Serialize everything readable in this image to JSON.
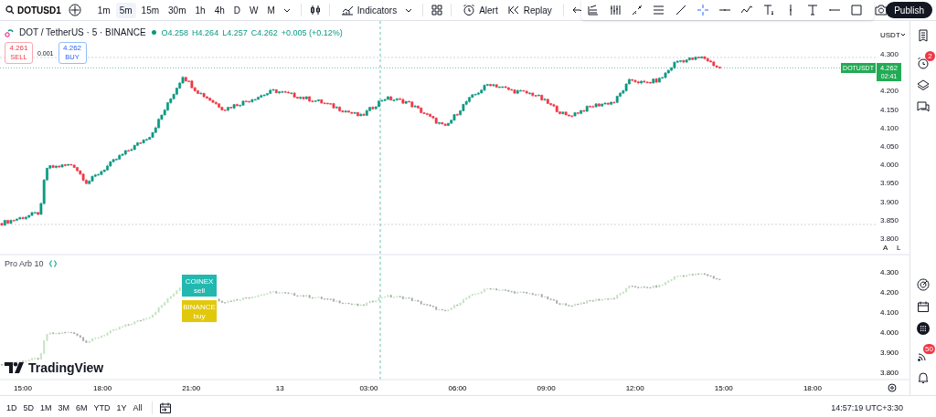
{
  "symbol_search": {
    "value": "DOTUSD1"
  },
  "intervals": [
    {
      "label": "1m",
      "selected": false
    },
    {
      "label": "5m",
      "selected": true
    },
    {
      "label": "15m",
      "selected": false
    },
    {
      "label": "30m",
      "selected": false
    },
    {
      "label": "1h",
      "selected": false
    },
    {
      "label": "4h",
      "selected": false
    },
    {
      "label": "D",
      "selected": false
    },
    {
      "label": "W",
      "selected": false
    },
    {
      "label": "M",
      "selected": false
    }
  ],
  "toolbar": {
    "indicators": "Indicators",
    "alert": "Alert",
    "replay": "Replay",
    "publish": "Publish"
  },
  "legend": {
    "title": "DOT / TetherUS · 5 · BINANCE",
    "ohlc": [
      {
        "label": "O",
        "value": "4.258"
      },
      {
        "label": "H",
        "value": "4.264"
      },
      {
        "label": "L",
        "value": "4.257"
      },
      {
        "label": "C",
        "value": "4.262"
      }
    ],
    "change": "+0.005 (+0.12%)"
  },
  "trade": {
    "sell_price": "4.261",
    "sell_label": "SELL",
    "spread": "0.001",
    "buy_price": "4.262",
    "buy_label": "BUY"
  },
  "price_axis": {
    "currency": "USDT",
    "labels": [
      "4.300",
      "4.200",
      "4.150",
      "4.100",
      "4.050",
      "4.000",
      "3.950",
      "3.900",
      "3.850",
      "3.800"
    ],
    "symbol_tag": "DOTUSDT",
    "last_price": "4.262",
    "countdown": "02:41",
    "scale_buttons": [
      "A",
      "L"
    ]
  },
  "indicator": {
    "name": "Pro Arb 10",
    "axis": [
      "4.300",
      "4.200",
      "4.100",
      "4.000",
      "3.900",
      "3.800"
    ],
    "signals": [
      {
        "exchange": "COINEX",
        "action": "sell",
        "color": "#22b8b0"
      },
      {
        "exchange": "BINANCE",
        "action": "buy",
        "color": "#e2c80a"
      }
    ]
  },
  "watermark_logo": "TradingView",
  "time_axis": [
    "15:00",
    "18:00",
    "21:00",
    "13",
    "03:00",
    "06:00",
    "09:00",
    "12:00",
    "15:00",
    "18:00"
  ],
  "ranges": [
    "1D",
    "5D",
    "1M",
    "3M",
    "6M",
    "YTD",
    "1Y",
    "All"
  ],
  "clock": "14:57:19 UTC+3:30",
  "sidebar": {
    "alerts_badge": "2",
    "notifications_badge": "50"
  }
}
